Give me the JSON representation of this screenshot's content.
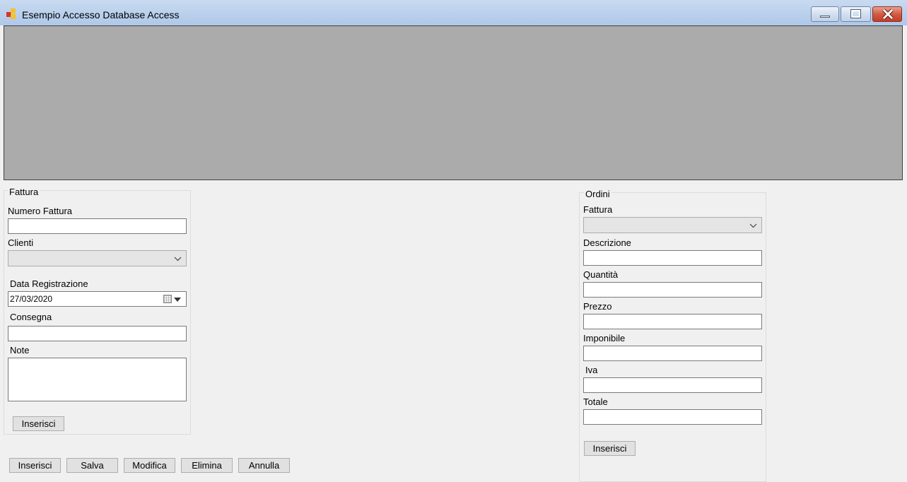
{
  "window": {
    "title": "Esempio Accesso Database Access",
    "icon": "app-icon",
    "controls": [
      "minimize-icon",
      "maximize-icon",
      "close-icon"
    ]
  },
  "fattura": {
    "group_title": "Fattura",
    "numero_label": "Numero Fattura",
    "numero_value": "",
    "clienti_label": "Clienti",
    "clienti_value": "",
    "data_label": "Data Registrazione",
    "data_value": "27/03/2020",
    "consegna_label": "Consegna",
    "consegna_value": "",
    "note_label": "Note",
    "note_value": "",
    "inserisci_label": "Inserisci"
  },
  "toolbar": {
    "inserisci": "Inserisci",
    "salva": "Salva",
    "modifica": "Modifica",
    "elimina": "Elimina",
    "annulla": "Annulla"
  },
  "ordini": {
    "group_title": "Ordini",
    "fattura_label": "Fattura",
    "fattura_value": "",
    "descrizione_label": "Descrizione",
    "descrizione_value": "",
    "quantita_label": "Quantità",
    "quantita_value": "",
    "prezzo_label": "Prezzo",
    "prezzo_value": "",
    "imponibile_label": "Imponibile",
    "imponibile_value": "",
    "iva_label": "Iva",
    "iva_value": "",
    "totale_label": "Totale",
    "totale_value": "",
    "inserisci_label": "Inserisci"
  },
  "colors": {
    "grid_background": "#ababab",
    "form_background": "#f0f0f0",
    "titlebar": "#b8cfec",
    "close_button": "#c23e28"
  }
}
